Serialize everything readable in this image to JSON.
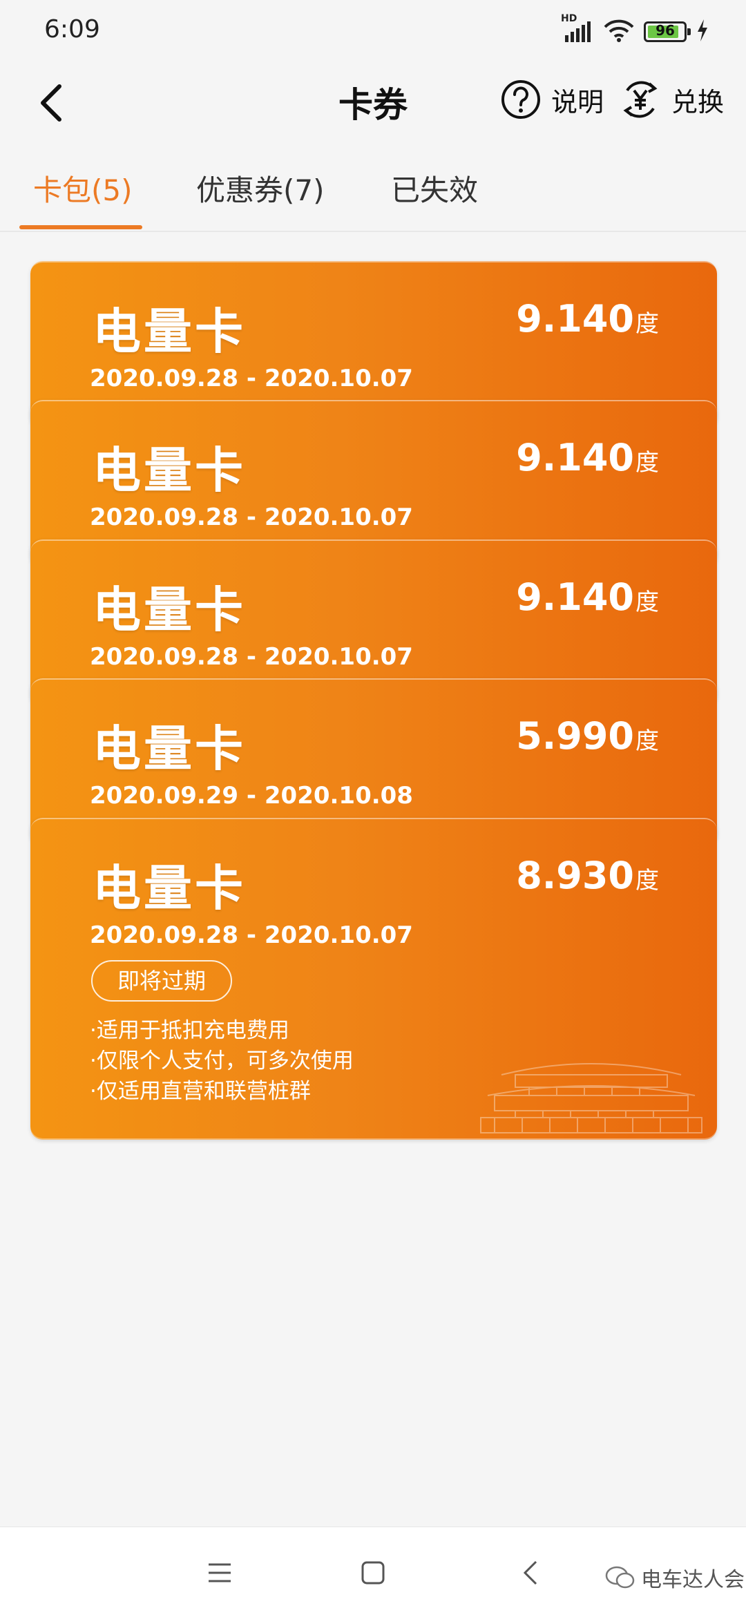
{
  "status_bar": {
    "time": "6:09",
    "network": "HD",
    "battery": "96"
  },
  "header": {
    "title": "卡券",
    "help_label": "说明",
    "exchange_label": "兑换"
  },
  "tabs": [
    {
      "label": "卡包(5)",
      "active": true
    },
    {
      "label": "优惠券(7)",
      "active": false
    },
    {
      "label": "已失效",
      "active": false
    }
  ],
  "cards": [
    {
      "name": "电量卡",
      "amount": "9.140",
      "unit": "度",
      "period": "2020.09.28 - 2020.10.07"
    },
    {
      "name": "电量卡",
      "amount": "9.140",
      "unit": "度",
      "period": "2020.09.28 - 2020.10.07"
    },
    {
      "name": "电量卡",
      "amount": "9.140",
      "unit": "度",
      "period": "2020.09.28 - 2020.10.07"
    },
    {
      "name": "电量卡",
      "amount": "5.990",
      "unit": "度",
      "period": "2020.09.29 - 2020.10.08"
    },
    {
      "name": "电量卡",
      "amount": "8.930",
      "unit": "度",
      "period": "2020.09.28 - 2020.10.07",
      "badge": "即将过期",
      "rules": [
        "·适用于抵扣充电费用",
        "·仅限个人支付，可多次使用",
        "·仅适用直营和联营桩群"
      ]
    }
  ],
  "watermark": "电车达人会",
  "colors": {
    "accent": "#ec7a24",
    "card_start": "#f49413",
    "card_end": "#e9680d"
  }
}
